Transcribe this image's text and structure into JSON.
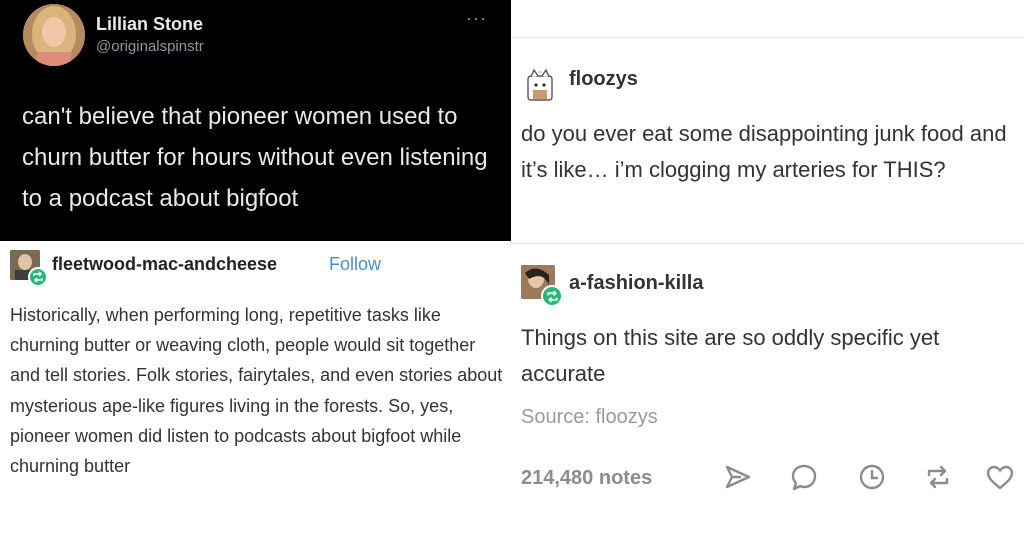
{
  "tweet": {
    "name": "Lillian Stone",
    "handle": "@originalspinstr",
    "more": "···",
    "text": "can't believe that pioneer women used to churn butter for hours without even listening to a podcast about bigfoot"
  },
  "post_left": {
    "username": "fleetwood-mac-andcheese",
    "follow": "Follow",
    "body": "Historically, when performing long, repetitive tasks like churning butter or weaving cloth, people would sit together and tell stories. Folk stories, fairytales, and even stories about mysterious ape-like figures living in the forests. So, yes, pioneer women did listen to podcasts about bigfoot while churning butter"
  },
  "post_right": {
    "op_username": "floozys",
    "op_text": "do you ever eat some disappointing junk food and it’s like… i’m clogging my arteries for THIS?",
    "reblogger_username": "a-fashion-killa",
    "reblogger_text": "Things on this site are so oddly specific yet accurate",
    "source": "Source: floozys",
    "notes": "214,480 notes"
  },
  "icons": {
    "share": "send-icon",
    "reply": "reply-bubble-icon",
    "queue": "clock-icon",
    "reblog": "reblog-icon",
    "like": "heart-icon",
    "badge": "reblog-badge-icon"
  },
  "colors": {
    "follow_link": "#4a90c8",
    "reblog_badge": "#27b878",
    "tweet_background": "#000000",
    "action_icons": "#8c8c8c"
  }
}
